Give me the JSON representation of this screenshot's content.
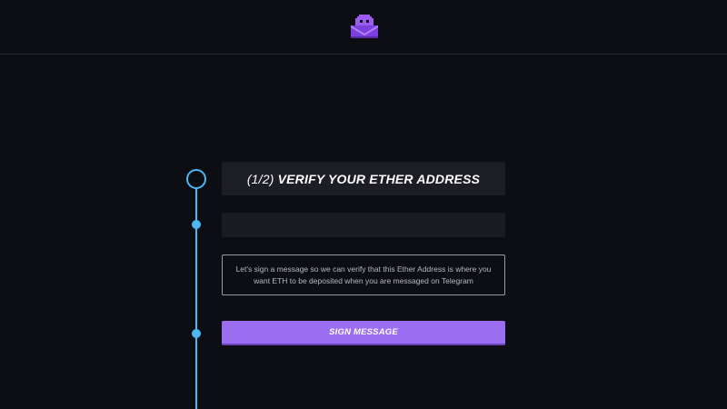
{
  "header": {
    "logo_icon": "pixel-ghost-mailbox-icon",
    "accent_color": "#9c5cf0"
  },
  "step": {
    "number": "(1/2)",
    "title": "VERIFY YOUR ETHER ADDRESS"
  },
  "address_field": {
    "value": "",
    "placeholder": ""
  },
  "info": {
    "text": "Let's sign a message so we can verify that this Ether Address is where you want ETH to be deposited when you are messaged on Telegram"
  },
  "actions": {
    "sign_label": "SIGN MESSAGE",
    "sign_color": "#9c6df0"
  },
  "timeline": {
    "color": "#4fb6f5"
  }
}
